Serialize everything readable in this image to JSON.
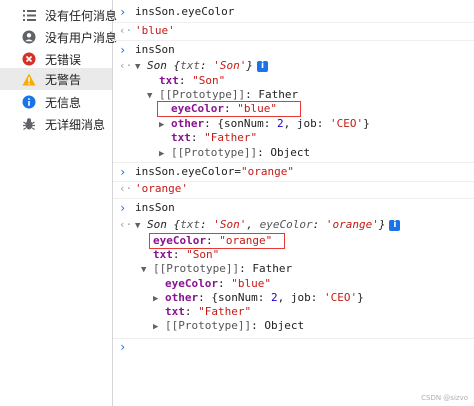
{
  "sidebar": {
    "items": [
      {
        "label": "没有任何消息",
        "icon": "list-icon"
      },
      {
        "label": "没有用户消息",
        "icon": "user-icon"
      },
      {
        "label": "无错误",
        "icon": "error-icon"
      },
      {
        "label": "无警告",
        "icon": "warning-icon"
      },
      {
        "label": "无信息",
        "icon": "info-icon"
      },
      {
        "label": "无详细消息",
        "icon": "bug-icon"
      }
    ],
    "selected": "无警告"
  },
  "console": {
    "cmd1": "insSon.eyeColor",
    "res1": "'blue'",
    "cmd2": "insSon",
    "obj1": {
      "head_class": "Son",
      "head_key": "txt",
      "head_val": "'Son'",
      "txt_key": "txt",
      "txt_val": "\"Son\"",
      "proto_key": "[[Prototype]]",
      "proto_val": "Father",
      "eye_key": "eyeColor",
      "eye_val": "\"blue\"",
      "other_key": "other",
      "other_val_open": "{sonNum: ",
      "other_num": "2",
      "other_mid": ", job: ",
      "other_job": "'CEO'",
      "other_close": "}",
      "ftxt_key": "txt",
      "ftxt_val": "\"Father\"",
      "proto2_key": "[[Prototype]]",
      "proto2_val": "Object"
    },
    "cmd3_prefix": "insSon.eyeColor=",
    "cmd3_value": "\"orange\"",
    "res3": "'orange'",
    "cmd4": "insSon",
    "obj2": {
      "head_class": "Son",
      "head_txt_key": "txt",
      "head_txt_val": "'Son'",
      "head_eye_key": "eyeColor",
      "head_eye_val": "'orange'",
      "eye_key": "eyeColor",
      "eye_val": "\"orange\"",
      "txt_key": "txt",
      "txt_val": "\"Son\"",
      "proto_key": "[[Prototype]]",
      "proto_val": "Father",
      "eye2_key": "eyeColor",
      "eye2_val": "\"blue\"",
      "other_key": "other",
      "other_val_open": "{sonNum: ",
      "other_num": "2",
      "other_mid": ", job: ",
      "other_job": "'CEO'",
      "other_close": "}",
      "ftxt_key": "txt",
      "ftxt_val": "\"Father\"",
      "proto2_key": "[[Prototype]]",
      "proto2_val": "Object"
    }
  },
  "watermark": "CSDN @sizvo",
  "colors": {
    "string": "#c41a16",
    "key": "#881391",
    "number": "#1c00cf",
    "accent": "#1a73e8",
    "highlight": "#e53935"
  }
}
